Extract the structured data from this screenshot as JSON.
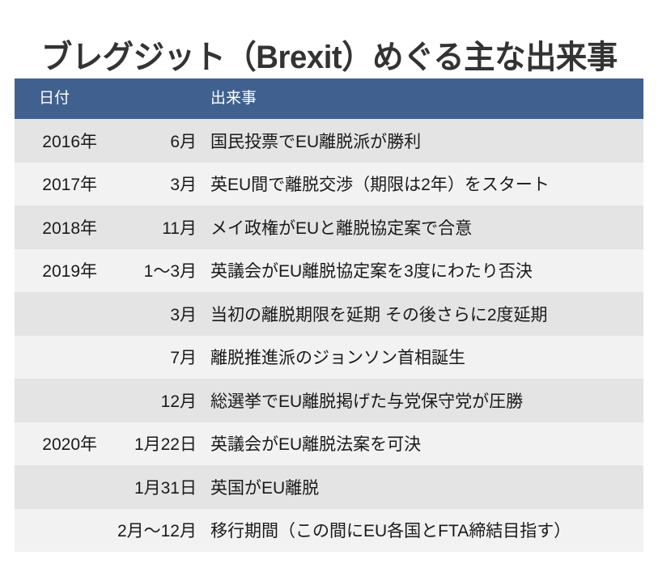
{
  "title": "ブレグジット（Brexit）めぐる主な出来事",
  "colors": {
    "header_background": "#40618f",
    "header_text": "#ffffff",
    "row_odd": "#e4e4e4",
    "row_even": "#f2f2f2",
    "body_text": "#1a1a1a",
    "title_text": "#333333",
    "page_background": "#ffffff"
  },
  "table": {
    "columns": [
      {
        "key": "date",
        "label": "日付"
      },
      {
        "key": "event",
        "label": "出来事"
      }
    ],
    "rows": [
      {
        "year": "2016年",
        "month": "6月",
        "event": "国民投票でEU離脱派が勝利"
      },
      {
        "year": "2017年",
        "month": "3月",
        "event": "英EU間で離脱交渉（期限は2年）をスタート"
      },
      {
        "year": "2018年",
        "month": "11月",
        "event": "メイ政権がEUと離脱協定案で合意"
      },
      {
        "year": "2019年",
        "month": "1〜3月",
        "event": "英議会がEU離脱協定案を3度にわたり否決"
      },
      {
        "year": "",
        "month": "3月",
        "event": "当初の離脱期限を延期 その後さらに2度延期"
      },
      {
        "year": "",
        "month": "7月",
        "event": "離脱推進派のジョンソン首相誕生"
      },
      {
        "year": "",
        "month": "12月",
        "event": "総選挙でEU離脱掲げた与党保守党が圧勝"
      },
      {
        "year": "2020年",
        "month": "1月22日",
        "event": "英議会がEU離脱法案を可決"
      },
      {
        "year": "",
        "month": "1月31日",
        "event": "英国がEU離脱"
      },
      {
        "year": "",
        "month": "2月〜12月",
        "event": "移行期間（この間にEU各国とFTA締結目指す）"
      }
    ]
  }
}
